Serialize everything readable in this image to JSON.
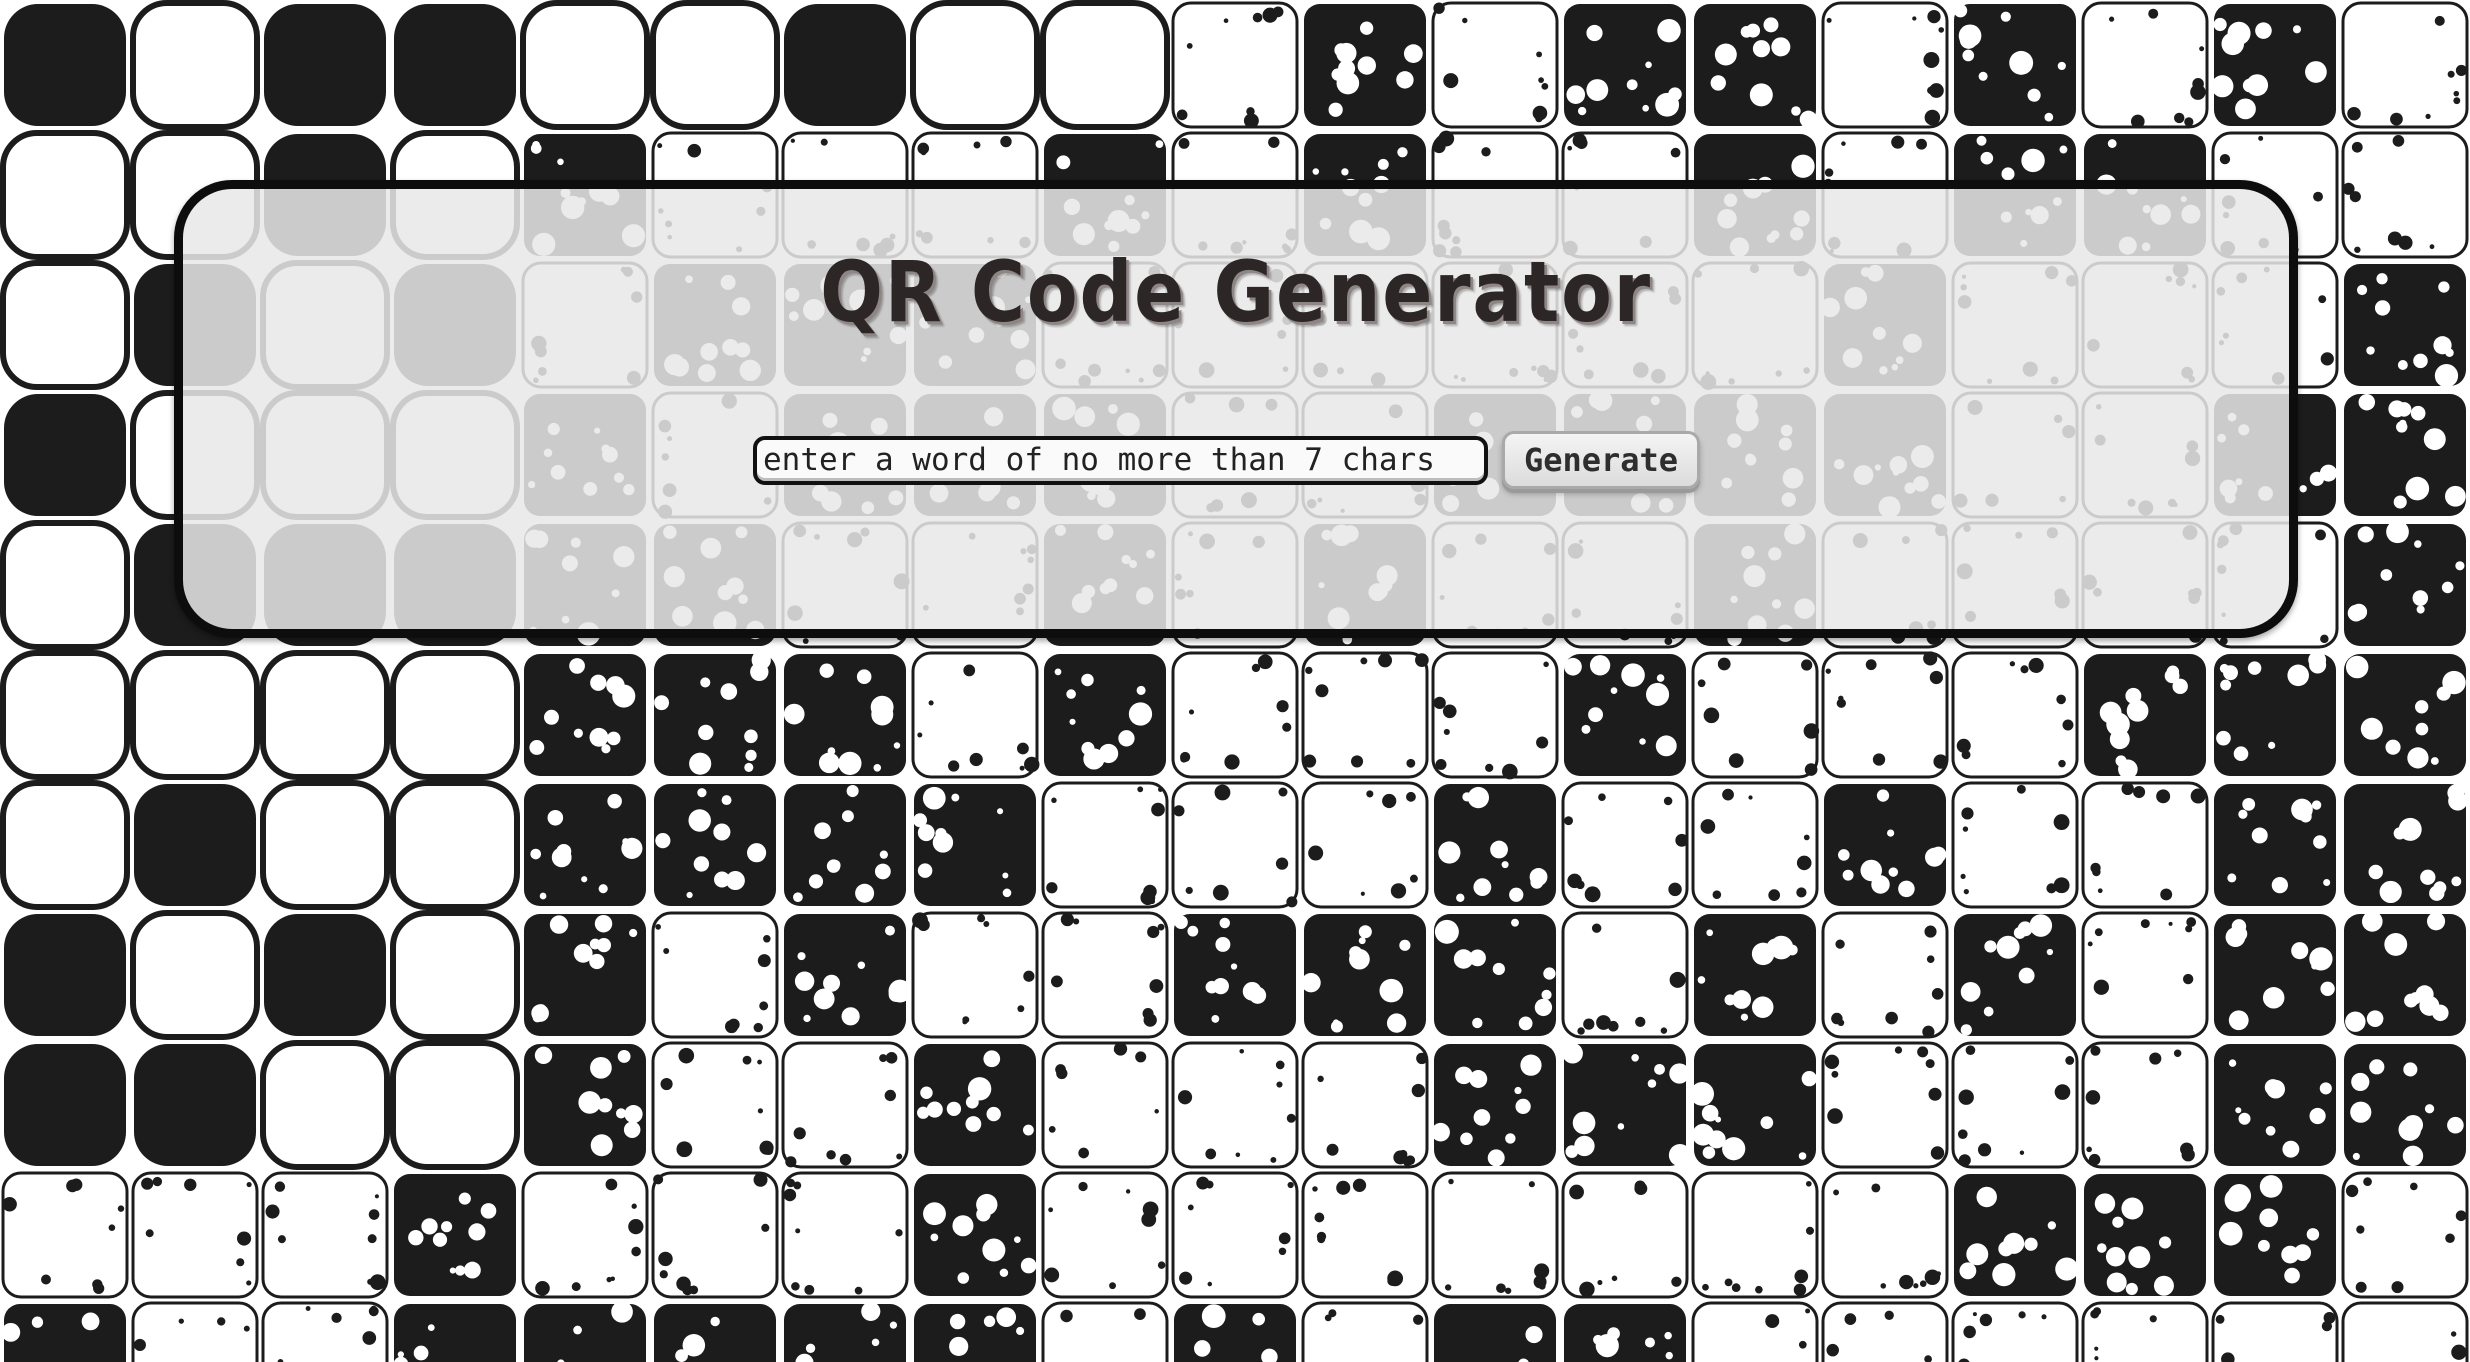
{
  "app": {
    "title": "QR Code Generator"
  },
  "form": {
    "input_value": "",
    "input_placeholder": "enter a word of no more than 7 chars",
    "generate_label": "Generate"
  },
  "colors": {
    "module_dark": "#1c1c1c",
    "module_light": "#ffffff",
    "panel_fill": "#e8e8e8",
    "panel_border": "#0d0d0d",
    "title_text": "#2c2626"
  }
}
